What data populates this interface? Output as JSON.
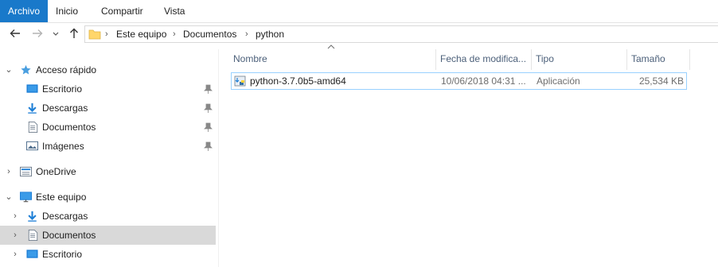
{
  "ribbon": {
    "tabs": [
      {
        "label": "Archivo",
        "active": true
      },
      {
        "label": "Inicio"
      },
      {
        "label": "Compartir"
      },
      {
        "label": "Vista"
      }
    ]
  },
  "address_bar": {
    "breadcrumbs": [
      "Este equipo",
      "Documentos",
      "python"
    ]
  },
  "sidebar": {
    "items": [
      {
        "label": "Acceso rápido",
        "icon": "star-icon",
        "expanded": true
      },
      {
        "label": "Escritorio",
        "icon": "desktop-icon",
        "pinned": true
      },
      {
        "label": "Descargas",
        "icon": "download-icon",
        "pinned": true
      },
      {
        "label": "Documentos",
        "icon": "documents-icon",
        "pinned": true
      },
      {
        "label": "Imágenes",
        "icon": "pictures-icon",
        "pinned": true
      },
      {
        "label": "OneDrive",
        "icon": "onedrive-icon",
        "expanded": false
      },
      {
        "label": "Este equipo",
        "icon": "computer-icon",
        "expanded": true
      },
      {
        "label": "Descargas",
        "icon": "download-icon"
      },
      {
        "label": "Documentos",
        "icon": "documents-icon",
        "selected": true
      },
      {
        "label": "Escritorio",
        "icon": "desktop-icon"
      }
    ]
  },
  "file_list": {
    "columns": [
      "Nombre",
      "Fecha de modifica...",
      "Tipo",
      "Tamaño"
    ],
    "sorted_by": "Nombre",
    "rows": [
      {
        "name": "python-3.7.0b5-amd64",
        "date": "10/06/2018 04:31 ...",
        "type": "Aplicación",
        "size": "25,534 KB",
        "icon": "installer-icon"
      }
    ]
  },
  "colors": {
    "accent": "#1979ca",
    "selection_border": "#99d1ff",
    "sidebar_selected": "#d9d9d9",
    "header_text": "#4c607a"
  }
}
